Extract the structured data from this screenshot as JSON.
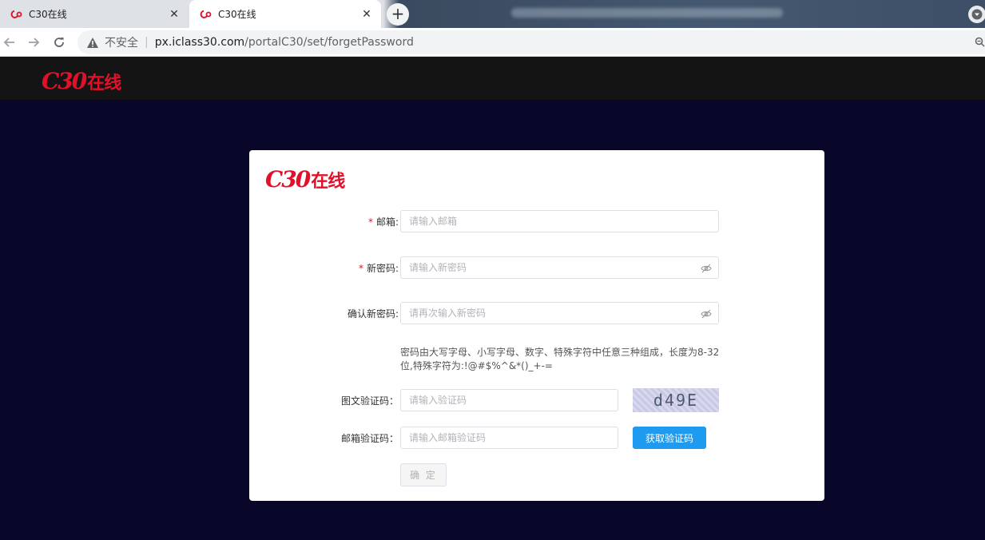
{
  "browser": {
    "tabs": [
      {
        "title": "C30在线",
        "active": false
      },
      {
        "title": "C30在线",
        "active": true
      }
    ],
    "new_tab_label": "+",
    "tab_close_label": "✕",
    "security_label": "不安全",
    "url_host": "px.iclass30.com",
    "url_path": "/portalC30/set/forgetPassword"
  },
  "header": {
    "logo_mark": "C30",
    "logo_text": "在线"
  },
  "form": {
    "logo_mark": "C30",
    "logo_text": "在线",
    "required_mark": "*",
    "email": {
      "label": "邮箱:",
      "placeholder": "请输入邮箱"
    },
    "new_password": {
      "label": "新密码:",
      "placeholder": "请输入新密码"
    },
    "confirm_password": {
      "label": "确认新密码:",
      "placeholder": "请再次输入新密码"
    },
    "password_hint": "密码由大写字母、小写字母、数字、特殊字符中任意三种组成，长度为8-32位,特殊字符为:!@#$%^&*()_+-=",
    "image_captcha": {
      "label": "图文验证码：",
      "placeholder": "请输入验证码",
      "captcha_text": "d49E"
    },
    "email_code": {
      "label": "邮箱验证码：",
      "placeholder": "请输入邮箱验证码",
      "button_label": "获取验证码"
    },
    "submit_label": "确 定"
  },
  "colors": {
    "brand_red": "#e3102a",
    "page_background": "#080629",
    "header_background": "#141414",
    "primary_button": "#1e9bf0"
  }
}
